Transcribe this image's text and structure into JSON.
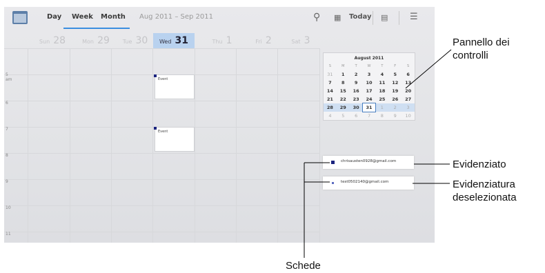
{
  "header": {
    "tabs": [
      "Day",
      "Week",
      "Month"
    ],
    "date_range": "Aug 2011 – Sep 2011",
    "today_label": "Today"
  },
  "days": [
    {
      "dow": "Sun",
      "num": "28"
    },
    {
      "dow": "Mon",
      "num": "29"
    },
    {
      "dow": "Tue",
      "num": "30"
    },
    {
      "dow": "Wed",
      "num": "31"
    },
    {
      "dow": "Thu",
      "num": "1"
    },
    {
      "dow": "Fri",
      "num": "2"
    },
    {
      "dow": "Sat",
      "num": "3"
    }
  ],
  "hours": [
    "5\nam",
    "6",
    "7",
    "8",
    "9",
    "10",
    "11"
  ],
  "events": [
    {
      "label": "Event"
    },
    {
      "label": "Event"
    }
  ],
  "mini_calendar": {
    "title": "August 2011",
    "weekday_headers": [
      "S",
      "M",
      "T",
      "W",
      "T",
      "F",
      "S"
    ],
    "weeks": [
      [
        "31",
        "1",
        "2",
        "3",
        "4",
        "5",
        "6"
      ],
      [
        "7",
        "8",
        "9",
        "10",
        "11",
        "12",
        "13"
      ],
      [
        "14",
        "15",
        "16",
        "17",
        "18",
        "19",
        "20"
      ],
      [
        "21",
        "22",
        "23",
        "24",
        "25",
        "26",
        "27"
      ],
      [
        "28",
        "29",
        "30",
        "31",
        "1",
        "2",
        "3"
      ],
      [
        "4",
        "5",
        "6",
        "7",
        "8",
        "9",
        "10"
      ]
    ]
  },
  "calendars": [
    {
      "email": "chrisausten0928@gmail.com",
      "color": "#1a237e"
    },
    {
      "email": "test0502140@gmail.com",
      "color": "#5c6bc0"
    }
  ],
  "callouts": {
    "controls_panel": "Pannello dei\ncontrolli",
    "highlighted": "Evidenziato",
    "deselected": "Evidenziatura\ndeselezionata",
    "tabs": "Schede"
  },
  "colors": {
    "accent": "#3a8de0",
    "current_day": "#b9d2ef"
  }
}
